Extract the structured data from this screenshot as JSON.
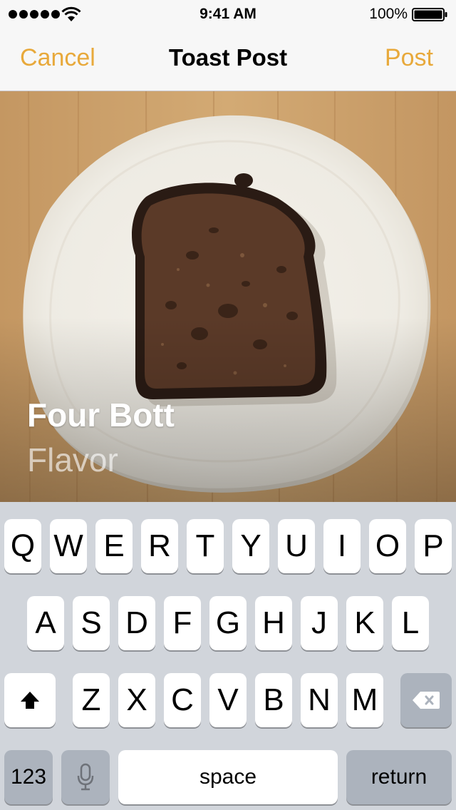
{
  "status_bar": {
    "time": "9:41 AM",
    "battery_percent": "100%",
    "signal_bars": 5,
    "icons": [
      "signal-dots-icon",
      "wifi-icon",
      "battery-icon"
    ]
  },
  "nav_bar": {
    "cancel_label": "Cancel",
    "title": "Toast Post",
    "post_label": "Post",
    "accent_color": "#e8a93b"
  },
  "photo": {
    "title": "Four Bott",
    "subtitle": "Flavor"
  },
  "keyboard": {
    "row1": [
      "Q",
      "W",
      "E",
      "R",
      "T",
      "Y",
      "U",
      "I",
      "O",
      "P"
    ],
    "row2": [
      "A",
      "S",
      "D",
      "F",
      "G",
      "H",
      "J",
      "K",
      "L"
    ],
    "row3": [
      "Z",
      "X",
      "C",
      "V",
      "B",
      "N",
      "M"
    ],
    "shift_icon": "shift-arrow-icon",
    "delete_icon": "backspace-icon",
    "numbers_label": "123",
    "mic_icon": "microphone-icon",
    "space_label": "space",
    "return_label": "return"
  }
}
